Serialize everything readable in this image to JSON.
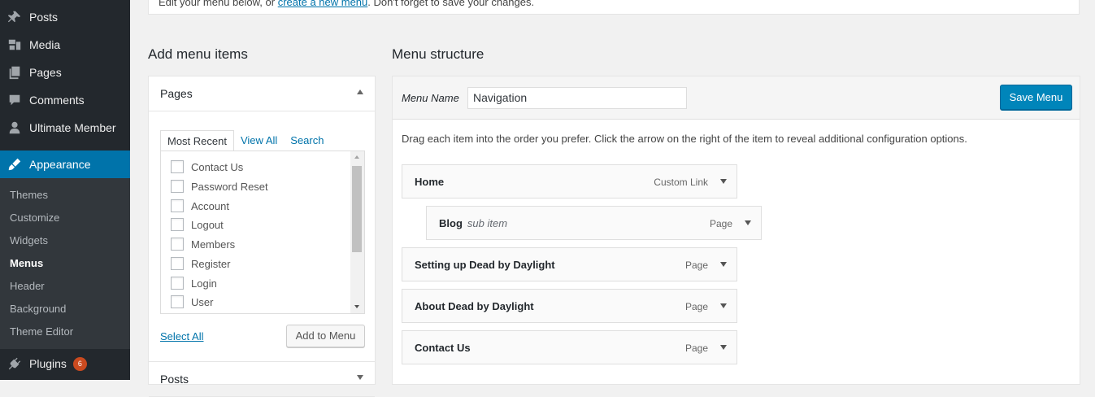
{
  "sidebar": {
    "items": [
      {
        "label": "Posts",
        "icon": "pin-icon"
      },
      {
        "label": "Media",
        "icon": "media-icon"
      },
      {
        "label": "Pages",
        "icon": "pages-icon"
      },
      {
        "label": "Comments",
        "icon": "comment-icon"
      },
      {
        "label": "Ultimate Member",
        "icon": "user-icon"
      },
      {
        "label": "Appearance",
        "icon": "brush-icon"
      },
      {
        "label": "Plugins",
        "icon": "plug-icon",
        "badge": "6"
      }
    ],
    "submenu": [
      "Themes",
      "Customize",
      "Widgets",
      "Menus",
      "Header",
      "Background",
      "Theme Editor"
    ],
    "accent": "#0073aa"
  },
  "notice": {
    "text_before": "Edit your menu below, or ",
    "link": "create a new menu",
    "text_after": ". Don't forget to save your changes."
  },
  "add_items": {
    "heading": "Add menu items",
    "pages_section": "Pages",
    "posts_section": "Posts",
    "tabs": [
      "Most Recent",
      "View All",
      "Search"
    ],
    "pages": [
      "Contact Us",
      "Password Reset",
      "Account",
      "Logout",
      "Members",
      "Register",
      "Login",
      "User"
    ],
    "select_all": "Select All",
    "add_button": "Add to Menu"
  },
  "structure": {
    "heading": "Menu structure",
    "menu_name_label": "Menu Name",
    "menu_name_value": "Navigation",
    "save_button": "Save Menu",
    "instructions": "Drag each item into the order you prefer. Click the arrow on the right of the item to reveal additional configuration options.",
    "items": [
      {
        "title": "Home",
        "sub": "",
        "type": "Custom Link"
      },
      {
        "title": "Blog",
        "sub": "sub item",
        "type": "Page"
      },
      {
        "title": "Setting up Dead by Daylight",
        "sub": "",
        "type": "Page"
      },
      {
        "title": "About Dead by Daylight",
        "sub": "",
        "type": "Page"
      },
      {
        "title": "Contact Us",
        "sub": "",
        "type": "Page"
      }
    ]
  }
}
